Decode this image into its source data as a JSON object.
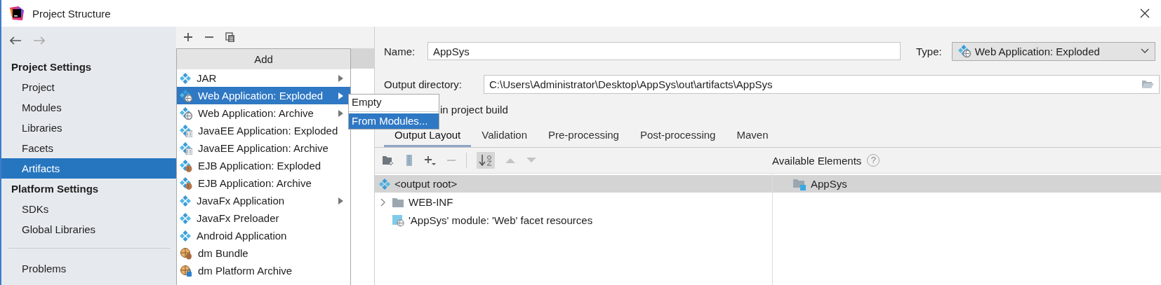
{
  "window": {
    "title": "Project Structure"
  },
  "sidebar": {
    "sections": [
      {
        "heading": "Project Settings",
        "items": [
          {
            "label": "Project",
            "selected": false
          },
          {
            "label": "Modules",
            "selected": false
          },
          {
            "label": "Libraries",
            "selected": false
          },
          {
            "label": "Facets",
            "selected": false
          },
          {
            "label": "Artifacts",
            "selected": true
          }
        ]
      },
      {
        "heading": "Platform Settings",
        "items": [
          {
            "label": "SDKs",
            "selected": false
          },
          {
            "label": "Global Libraries",
            "selected": false
          }
        ]
      }
    ],
    "bottom_items": [
      {
        "label": "Problems",
        "selected": false
      }
    ]
  },
  "add_menu": {
    "title": "Add",
    "items": [
      {
        "label": "JAR",
        "kind": "artifact",
        "submenu": true,
        "selected": false
      },
      {
        "label": "Web Application: Exploded",
        "kind": "web",
        "submenu": true,
        "selected": true
      },
      {
        "label": "Web Application: Archive",
        "kind": "web",
        "submenu": true,
        "selected": false
      },
      {
        "label": "JavaEE Application: Exploded",
        "kind": "javaee",
        "submenu": false,
        "selected": false
      },
      {
        "label": "JavaEE Application: Archive",
        "kind": "javaee",
        "submenu": false,
        "selected": false
      },
      {
        "label": "EJB Application: Exploded",
        "kind": "ejb",
        "submenu": false,
        "selected": false
      },
      {
        "label": "EJB Application: Archive",
        "kind": "ejb",
        "submenu": false,
        "selected": false
      },
      {
        "label": "JavaFx Application",
        "kind": "artifact",
        "submenu": true,
        "selected": false
      },
      {
        "label": "JavaFx Preloader",
        "kind": "artifact",
        "submenu": false,
        "selected": false
      },
      {
        "label": "Android Application",
        "kind": "artifact",
        "submenu": false,
        "selected": false
      },
      {
        "label": "dm Bundle",
        "kind": "bundle",
        "submenu": false,
        "selected": false
      },
      {
        "label": "dm Platform Archive",
        "kind": "platform",
        "submenu": false,
        "selected": false
      }
    ]
  },
  "submenu": {
    "items": [
      {
        "label": "Empty",
        "selected": false
      },
      {
        "label": "From Modules...",
        "selected": true
      }
    ]
  },
  "artifact": {
    "name_label": "Name:",
    "name": "AppSys",
    "type_label": "Type:",
    "type": "Web Application: Exploded",
    "output_label": "Output directory:",
    "output": "C:\\Users\\Administrator\\Desktop\\AppSys\\out\\artifacts\\AppSys",
    "build_option": "in project build"
  },
  "tabs": [
    {
      "label": "Output Layout",
      "selected": true
    },
    {
      "label": "Validation",
      "selected": false
    },
    {
      "label": "Pre-processing",
      "selected": false
    },
    {
      "label": "Post-processing",
      "selected": false
    },
    {
      "label": "Maven",
      "selected": false
    }
  ],
  "available_elements": {
    "title": "Available Elements",
    "help": "?"
  },
  "layout_tree": [
    {
      "label": "<output root>",
      "kind": "root",
      "selected": true,
      "children": [
        {
          "label": "WEB-INF",
          "kind": "folder",
          "selected": false,
          "expanded": false
        },
        {
          "label": "'AppSys' module: 'Web' facet resources",
          "kind": "resources",
          "selected": false
        }
      ]
    }
  ],
  "available_tree": [
    {
      "label": "AppSys",
      "kind": "module",
      "selected": true
    }
  ]
}
